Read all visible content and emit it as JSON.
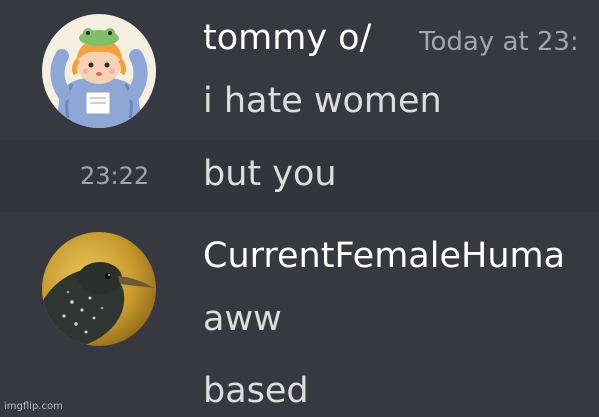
{
  "messages": [
    {
      "author": "tommy o/",
      "timestamp": "Today at 23:",
      "avatar_icon": "cartoon-boy-frog-hat-avatar",
      "lines": [
        {
          "text": "i hate women"
        },
        {
          "text": "but you",
          "side_time": "23:22"
        }
      ]
    },
    {
      "author": "CurrentFemaleHuma",
      "avatar_icon": "starling-bird-avatar",
      "lines": [
        {
          "text": "aww"
        },
        {
          "text": "based"
        }
      ]
    }
  ],
  "watermark": "imgflip.com",
  "colors": {
    "background": "#36393f",
    "hover_row": "#32353b",
    "username": "#ffffff",
    "message_text": "#dcddde",
    "timestamp": "#a3a6aa"
  }
}
